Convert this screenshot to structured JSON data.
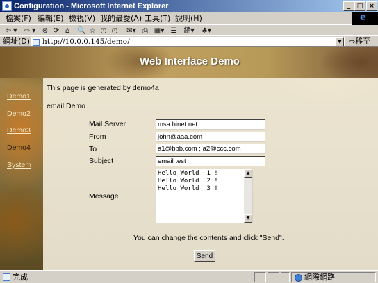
{
  "window": {
    "title": "Configuration - Microsoft Internet Explorer",
    "minimize_glyph": "_",
    "maximize_glyph": "□",
    "close_glyph": "×"
  },
  "menu": {
    "items": [
      "檔案(F)",
      "編輯(E)",
      "檢視(V)",
      "我的最愛(A)",
      "工具(T)",
      "說明(H)"
    ]
  },
  "toolbar": {
    "back": "⇦ ▾",
    "forward": "⇨ ▾",
    "stop": "⊗",
    "refresh": "⟳",
    "home": "⌂",
    "search": "🔍",
    "favorites": "☆",
    "history": "◷",
    "mail": "✉▾",
    "print": "⎙",
    "edit": "▦▾",
    "discuss": "☰",
    "fonts": "縮▾",
    "messenger": "♣▾"
  },
  "address": {
    "label": "網址(D)",
    "url": "http://10.0.0.145/demo/",
    "go_label": "⇨移至",
    "dropdown_glyph": "▼"
  },
  "page": {
    "banner_title": "Web Interface Demo",
    "sidebar_links": [
      "Demo1",
      "Demo2",
      "Demo3",
      "Demo4",
      "System"
    ],
    "active_link": "Demo4",
    "intro": "This page is generated by demo4a",
    "section_title": "email Demo",
    "form": {
      "mail_server_label": "Mail Server",
      "mail_server_value": "msa.hinet.net",
      "from_label": "From",
      "from_value": "john@aaa.com",
      "to_label": "To",
      "to_value": "a1@bbb.com ; a2@ccc.com",
      "subject_label": "Subject",
      "subject_value": "email test",
      "message_label": "Message",
      "message_lines": [
        "Hello World  1 !",
        "Hello World  2 !",
        "Hello World  3 !"
      ]
    },
    "hint": "You can change the contents and click \"Send\".",
    "send_label": "Send"
  },
  "status": {
    "text": "完成",
    "zone": "網際網路"
  }
}
